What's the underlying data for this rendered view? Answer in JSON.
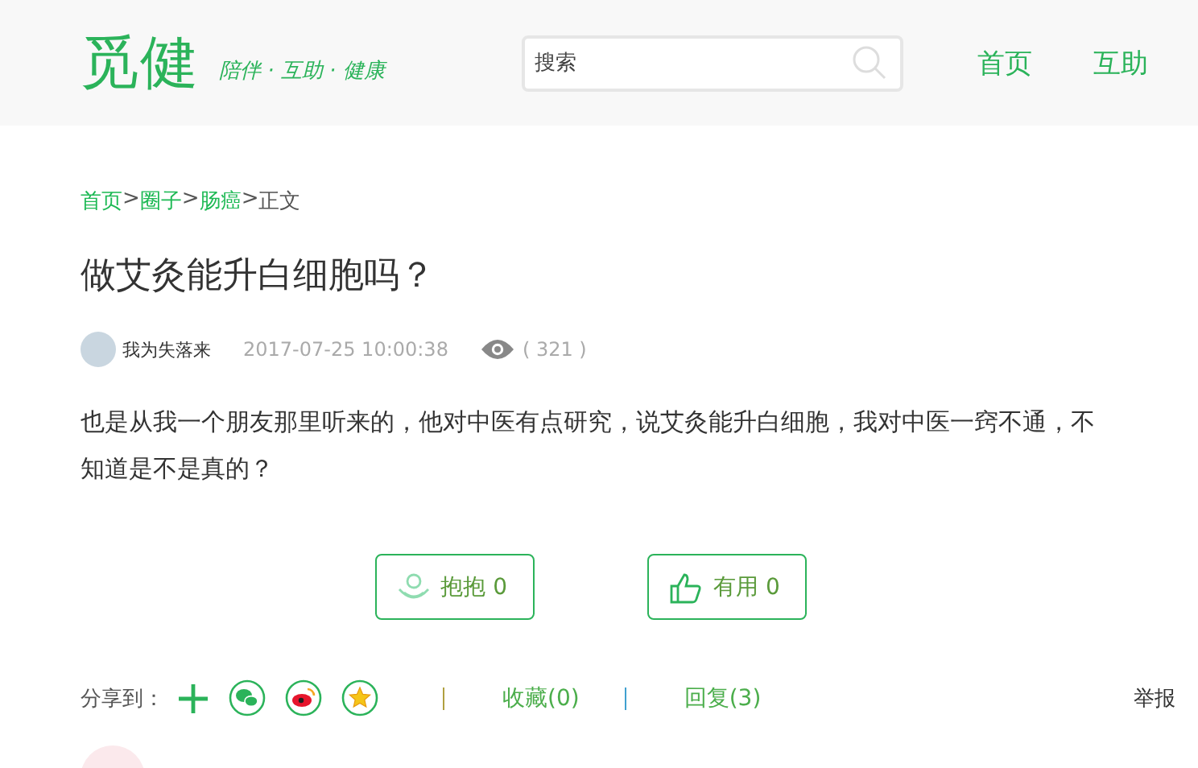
{
  "header": {
    "logo": "觅健",
    "slogan": "陪伴 · 互助 · 健康",
    "search": {
      "placeholder": "搜索"
    },
    "nav": [
      {
        "label": "首页"
      },
      {
        "label": "互助"
      }
    ]
  },
  "breadcrumb": {
    "separator": ">",
    "items": [
      {
        "label": "首页",
        "kind": "link"
      },
      {
        "label": "圈子",
        "kind": "link"
      },
      {
        "label": "肠癌",
        "kind": "link"
      },
      {
        "label": "正文",
        "kind": "current"
      }
    ]
  },
  "post": {
    "title": "做艾灸能升白细胞吗？",
    "author": "我为失落来",
    "time": "2017-07-25 10:00:38",
    "views": "( 321 )",
    "body": "也是从我一个朋友那里听来的，他对中医有点研究，说艾灸能升白细胞，我对中医一窍不通，不知道是不是真的？"
  },
  "actions": [
    {
      "kind": "hug",
      "label": "抱抱 0"
    },
    {
      "kind": "useful",
      "label": "有用 0"
    }
  ],
  "share": {
    "label": "分享到：",
    "icons": [
      {
        "kind": "plus"
      },
      {
        "kind": "wechat"
      },
      {
        "kind": "weibo"
      },
      {
        "kind": "star"
      }
    ],
    "links": [
      {
        "label": "收藏(0)"
      },
      {
        "label": "回复(3)"
      }
    ],
    "report": "举报"
  }
}
